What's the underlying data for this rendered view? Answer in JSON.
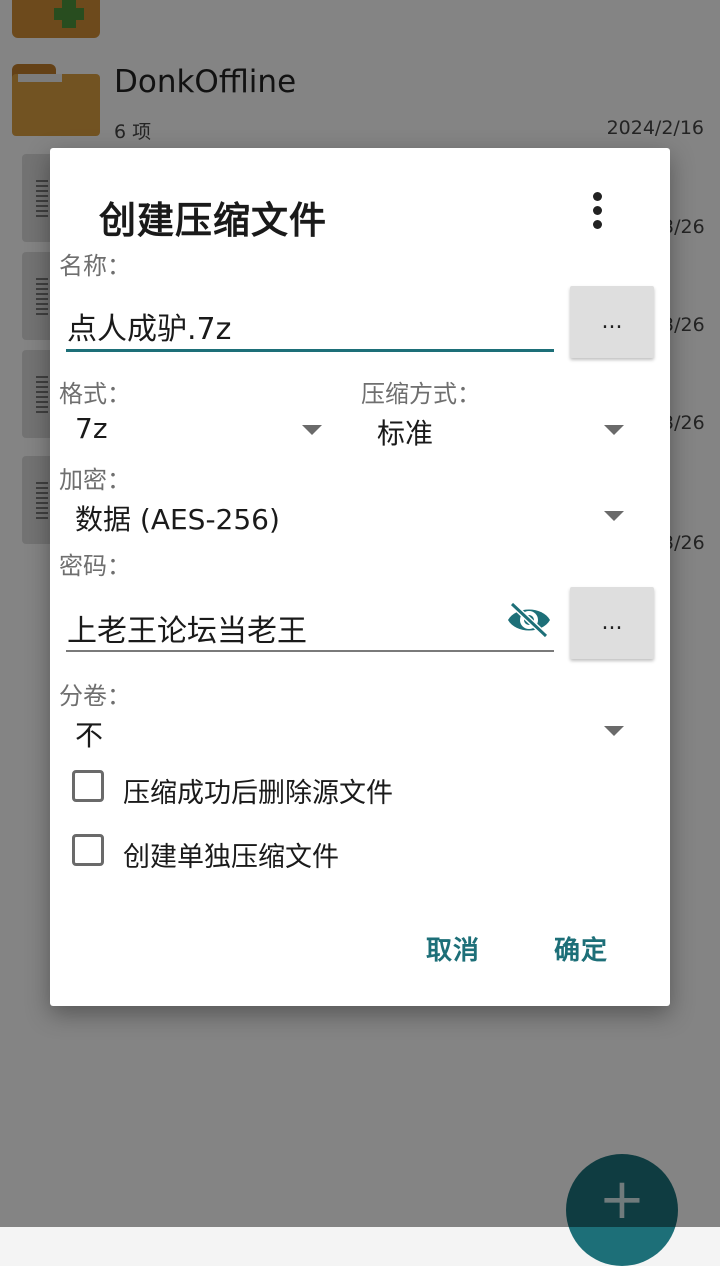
{
  "background": {
    "folder": {
      "name": "DonkOffline",
      "count": "6 项",
      "date": "2024/2/16"
    },
    "file_dates": [
      "3/26",
      "3/26",
      "3/26",
      "3/26"
    ],
    "fab_icon": "plus-icon"
  },
  "dialog": {
    "title": "创建压缩文件",
    "menu_icon": "more-vert-icon",
    "name": {
      "label": "名称：",
      "value": "点人成驴.7z",
      "browse_label": "..."
    },
    "format": {
      "label": "格式：",
      "value": "7z"
    },
    "compression": {
      "label": "压缩方式：",
      "value": "标准"
    },
    "encryption": {
      "label": "加密：",
      "value": "数据 (AES-256)"
    },
    "password": {
      "label": "密码：",
      "value": "上老王论坛当老王",
      "visibility_icon": "eye-off-icon",
      "browse_label": "..."
    },
    "split": {
      "label": "分卷：",
      "value": "不"
    },
    "checkboxes": [
      {
        "label": "压缩成功后删除源文件",
        "checked": false
      },
      {
        "label": "创建单独压缩文件",
        "checked": false
      }
    ],
    "actions": {
      "cancel": "取消",
      "ok": "确定"
    },
    "accent_color": "#1d6f78"
  }
}
